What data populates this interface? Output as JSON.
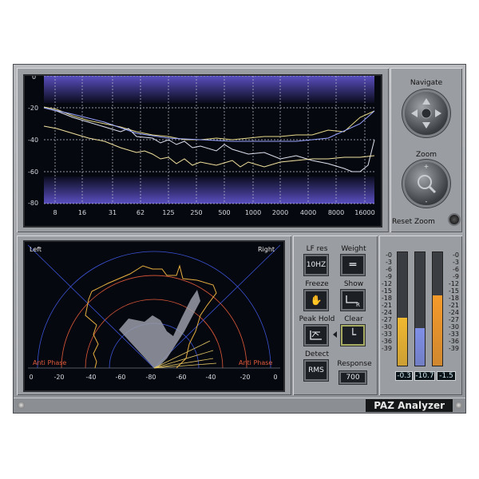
{
  "title": "PAZ Analyzer",
  "freq": {
    "y_labels": [
      "0",
      "-20",
      "-40",
      "-60",
      "-80"
    ],
    "x_labels": [
      "8",
      "16",
      "31",
      "62",
      "125",
      "250",
      "500",
      "1000",
      "2000",
      "4000",
      "8000",
      "16000"
    ]
  },
  "nav": {
    "navigate": "Navigate",
    "zoom": "Zoom",
    "reset_zoom": "Reset Zoom"
  },
  "stereo": {
    "left": "Left",
    "right": "Right",
    "anti_phase_left": "Anti Phase",
    "anti_phase_right": "Anti Phase",
    "x_labels": [
      "0",
      "-20",
      "-40",
      "-60",
      "-80",
      "-60",
      "-40",
      "-20",
      "0"
    ]
  },
  "controls": {
    "lf_res": "LF res",
    "lf_res_value": "10HZ",
    "weight": "Weight",
    "weight_glyph": "═",
    "freeze": "Freeze",
    "freeze_glyph": "✋",
    "show": "Show",
    "peak_hold": "Peak Hold",
    "clear": "Clear",
    "clear_glyph": "└",
    "detect": "Detect",
    "detect_value": "RMS",
    "response": "Response",
    "response_value": "700"
  },
  "meters": {
    "scale": [
      "-0",
      "-3",
      "-6",
      "-9",
      "-12",
      "-15",
      "-18",
      "-21",
      "-24",
      "-27",
      "-30",
      "-33",
      "-36",
      "-39"
    ],
    "readouts": [
      "-0.3",
      "-10.7",
      "-1.5"
    ],
    "levels": [
      0.42,
      0.33,
      0.62
    ],
    "colors": [
      "#f0b830",
      "#7f8fe6",
      "#f59a2a"
    ]
  }
}
